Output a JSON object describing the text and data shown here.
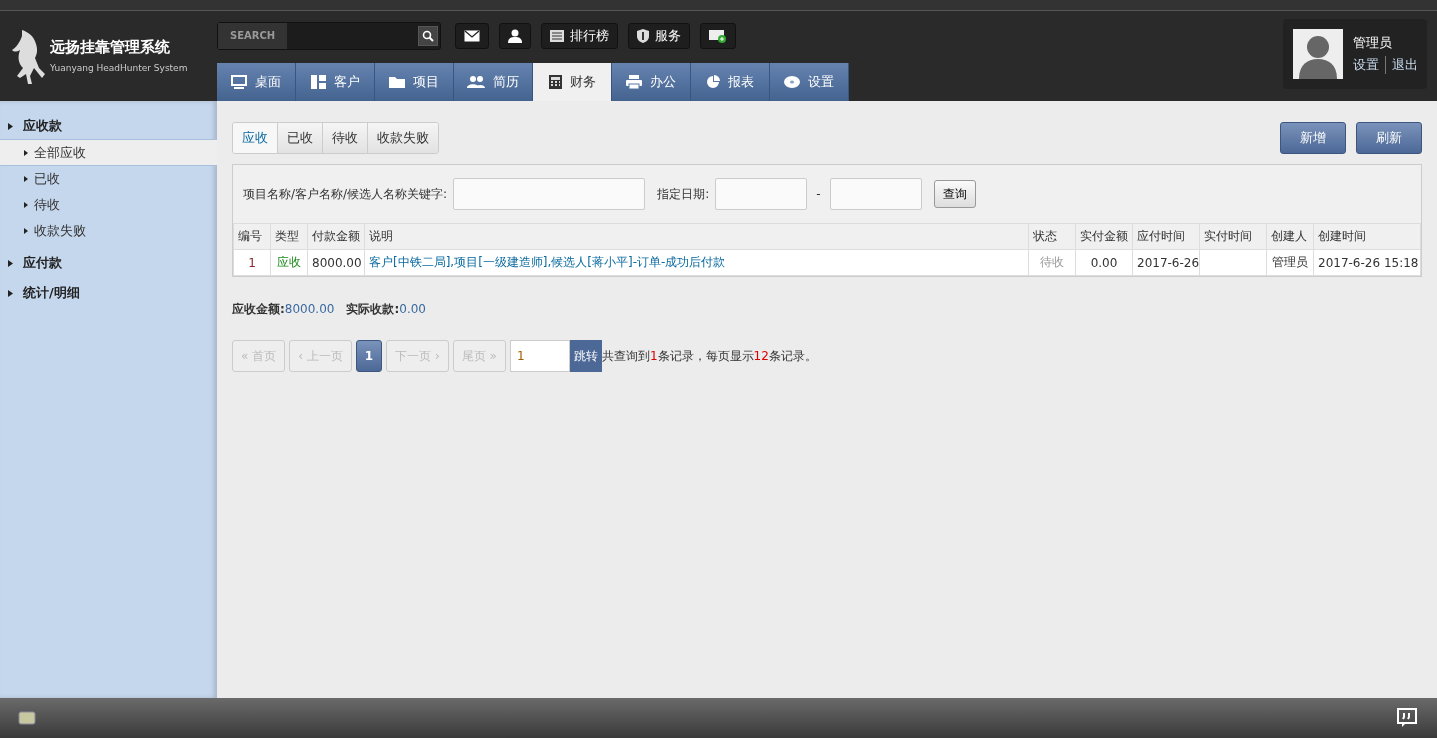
{
  "logo": {
    "title": "远扬挂靠管理系统",
    "subtitle": "Yuanyang HeadHunter System"
  },
  "search": {
    "label": "SEARCH"
  },
  "toolbar": [
    {
      "kind": "mail"
    },
    {
      "kind": "user"
    },
    {
      "kind": "list",
      "label": "排行榜"
    },
    {
      "kind": "shield",
      "label": "服务"
    },
    {
      "kind": "note"
    }
  ],
  "nav_tabs": [
    {
      "kind": "monitor",
      "label": "桌面",
      "selected": false
    },
    {
      "kind": "panels",
      "label": "客户",
      "selected": false
    },
    {
      "kind": "folder",
      "label": "项目",
      "selected": false
    },
    {
      "kind": "people",
      "label": "简历",
      "selected": false
    },
    {
      "kind": "calculator",
      "label": "财务",
      "selected": true
    },
    {
      "kind": "printer",
      "label": "办公",
      "selected": false
    },
    {
      "kind": "pie",
      "label": "报表",
      "selected": false
    },
    {
      "kind": "disc",
      "label": "设置",
      "selected": false
    }
  ],
  "user": {
    "name": "管理员",
    "links": [
      "设置",
      "退出"
    ]
  },
  "sidebar": [
    {
      "label": "应收款",
      "children": [
        {
          "label": "全部应收",
          "selected": true
        },
        {
          "label": "已收",
          "selected": false
        },
        {
          "label": "待收",
          "selected": false
        },
        {
          "label": "收款失败",
          "selected": false
        }
      ]
    },
    {
      "label": "应付款"
    },
    {
      "label": "统计/明细"
    }
  ],
  "sub_tabs": [
    {
      "label": "应收",
      "selected": true
    },
    {
      "label": "已收",
      "selected": false
    },
    {
      "label": "待收",
      "selected": false
    },
    {
      "label": "收款失败",
      "selected": false
    }
  ],
  "actions": [
    "新增",
    "刷新"
  ],
  "filter": {
    "keyword_label": "项目名称/客户名称/候选人名称关键字:",
    "date_label": "指定日期:",
    "separator": "-",
    "button": "查询"
  },
  "table": {
    "columns": [
      "编号",
      "类型",
      "付款金额",
      "说明",
      "状态",
      "实付金额",
      "应付时间",
      "实付时间",
      "创建人",
      "创建时间"
    ],
    "rows": [
      {
        "cells": [
          "1",
          "应收",
          "8000.00",
          "客户[中铁二局],项目[一级建造师],候选人[蒋小平]-订单-成功后付款",
          "待收",
          "0.00",
          "2017-6-26",
          "",
          "管理员",
          "2017-6-26 15:18"
        ]
      }
    ]
  },
  "summary": [
    {
      "label": "应收金额:",
      "value": "8000.00"
    },
    {
      "label": "实际收款:",
      "value": "0.00"
    }
  ],
  "pagination": {
    "pages": [
      {
        "label": "« 首页",
        "selected": false,
        "disabled": true
      },
      {
        "label": "‹ 上一页",
        "selected": false,
        "disabled": true
      },
      {
        "label": "1",
        "selected": true,
        "disabled": false
      },
      {
        "label": "下一页 ›",
        "selected": false,
        "disabled": true
      },
      {
        "label": "尾页 »",
        "selected": false,
        "disabled": true
      }
    ],
    "page_input": "1",
    "jump": "跳转",
    "info": [
      {
        "text": "共查询到",
        "highlight": false
      },
      {
        "text": "1",
        "highlight": true
      },
      {
        "text": "条记录，每页显示",
        "highlight": false
      },
      {
        "text": "12",
        "highlight": true
      },
      {
        "text": "条记录。",
        "highlight": false
      }
    ]
  },
  "footer": [
    {
      "kind": "screen"
    },
    {
      "kind": "comment"
    }
  ]
}
